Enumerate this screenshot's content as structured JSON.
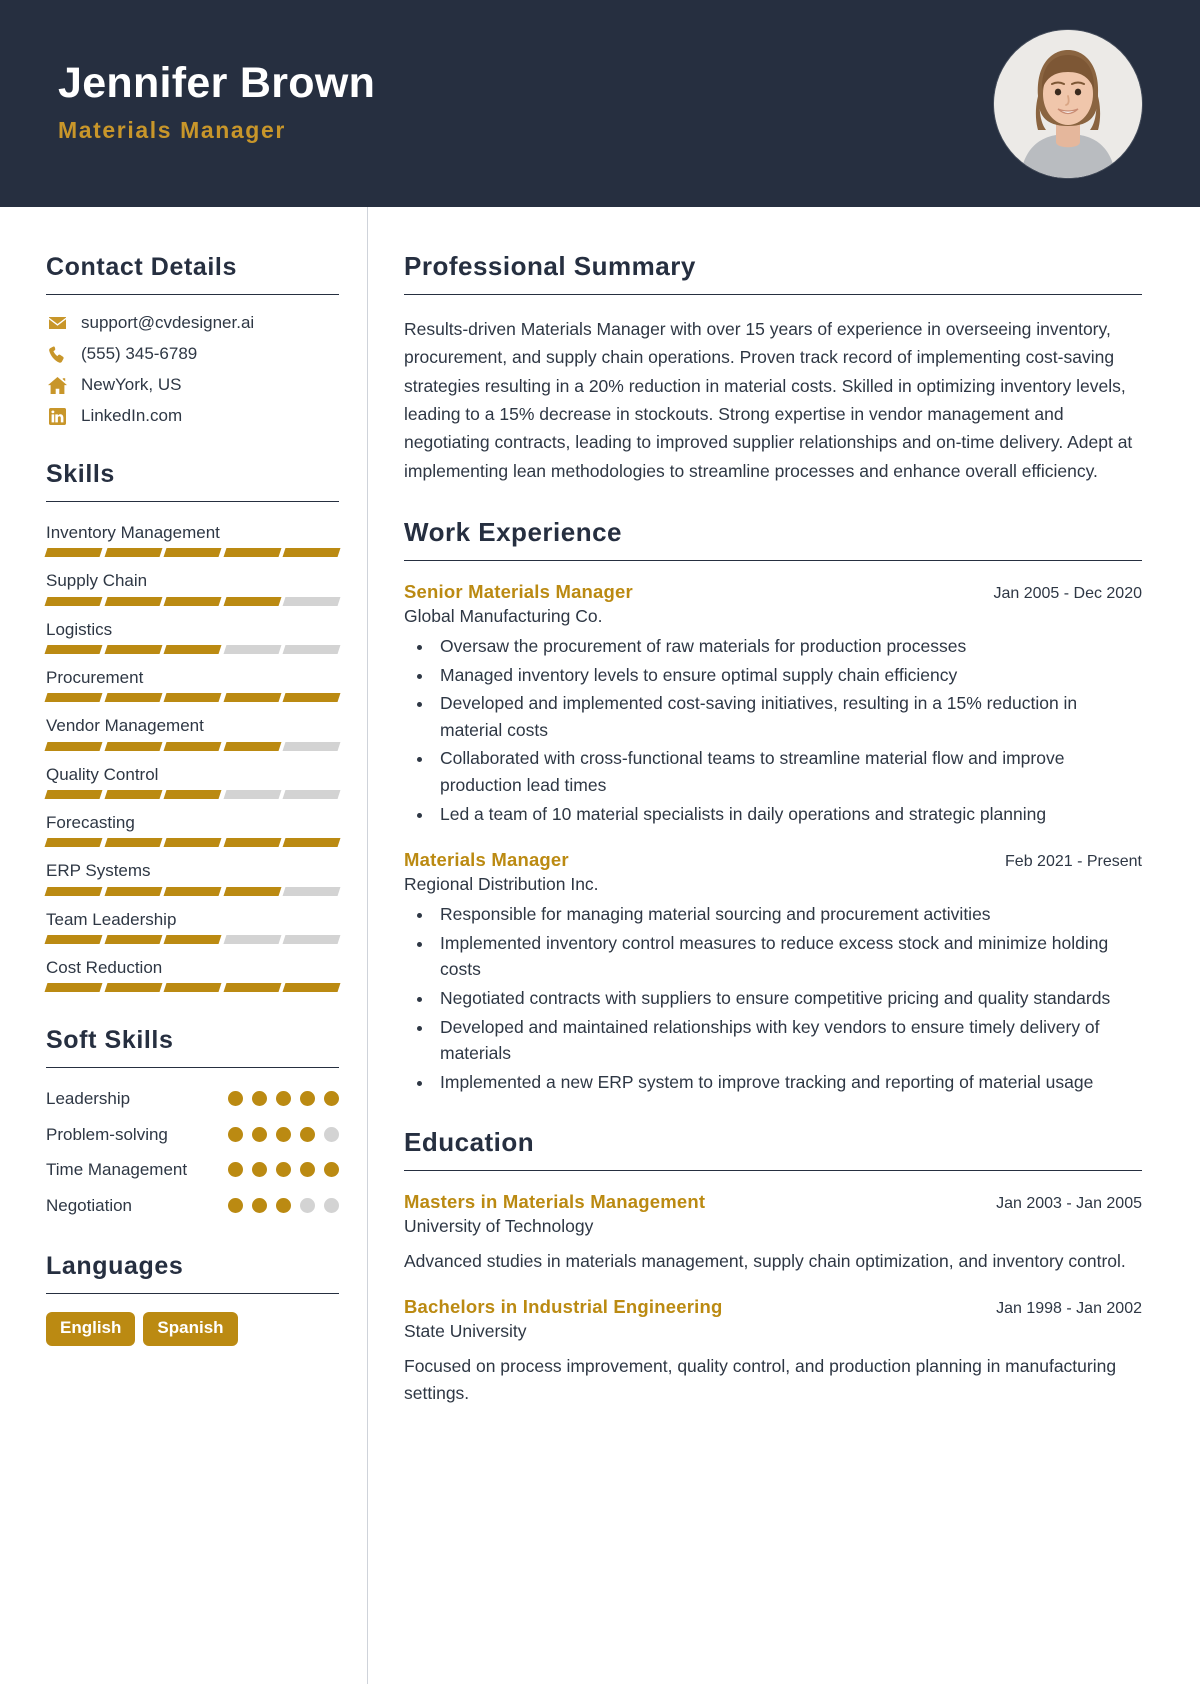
{
  "header": {
    "name": "Jennifer Brown",
    "role": "Materials Manager",
    "avatar_alt": "profile-photo"
  },
  "colors": {
    "header_bg": "#262f40",
    "accent": "#bb8a12",
    "role_accent": "#c8962a",
    "text": "#2e3744",
    "muted_bar": "#d3d3d3"
  },
  "sidebar": {
    "contact": {
      "title": "Contact Details",
      "items": [
        {
          "icon": "envelope-icon",
          "value": "support@cvdesigner.ai"
        },
        {
          "icon": "phone-icon",
          "value": "(555) 345-6789"
        },
        {
          "icon": "home-icon",
          "value": "NewYork, US"
        },
        {
          "icon": "linkedin-icon",
          "value": "LinkedIn.com"
        }
      ]
    },
    "skills": {
      "title": "Skills",
      "max": 5,
      "items": [
        {
          "label": "Inventory Management",
          "level": 5
        },
        {
          "label": "Supply Chain",
          "level": 4
        },
        {
          "label": "Logistics",
          "level": 3
        },
        {
          "label": "Procurement",
          "level": 5
        },
        {
          "label": "Vendor Management",
          "level": 4
        },
        {
          "label": "Quality Control",
          "level": 3
        },
        {
          "label": "Forecasting",
          "level": 5
        },
        {
          "label": "ERP Systems",
          "level": 4
        },
        {
          "label": "Team Leadership",
          "level": 3
        },
        {
          "label": "Cost Reduction",
          "level": 5
        }
      ]
    },
    "soft_skills": {
      "title": "Soft Skills",
      "max": 5,
      "items": [
        {
          "label": "Leadership",
          "level": 5
        },
        {
          "label": "Problem-solving",
          "level": 4
        },
        {
          "label": "Time Management",
          "level": 5
        },
        {
          "label": "Negotiation",
          "level": 3
        }
      ]
    },
    "languages": {
      "title": "Languages",
      "items": [
        "English",
        "Spanish"
      ]
    }
  },
  "main": {
    "summary": {
      "title": "Professional Summary",
      "text": "Results-driven Materials Manager with over 15 years of experience in overseeing inventory, procurement, and supply chain operations. Proven track record of implementing cost-saving strategies resulting in a 20% reduction in material costs. Skilled in optimizing inventory levels, leading to a 15% decrease in stockouts. Strong expertise in vendor management and negotiating contracts, leading to improved supplier relationships and on-time delivery. Adept at implementing lean methodologies to streamline processes and enhance overall efficiency."
    },
    "work": {
      "title": "Work Experience",
      "jobs": [
        {
          "title": "Senior Materials Manager",
          "date": "Jan 2005 - Dec 2020",
          "org": "Global Manufacturing Co.",
          "bullets": [
            "Oversaw the procurement of raw materials for production processes",
            "Managed inventory levels to ensure optimal supply chain efficiency",
            "Developed and implemented cost-saving initiatives, resulting in a 15% reduction in material costs",
            "Collaborated with cross-functional teams to streamline material flow and improve production lead times",
            "Led a team of 10 material specialists in daily operations and strategic planning"
          ]
        },
        {
          "title": "Materials Manager",
          "date": "Feb 2021 - Present",
          "org": "Regional Distribution Inc.",
          "bullets": [
            "Responsible for managing material sourcing and procurement activities",
            "Implemented inventory control measures to reduce excess stock and minimize holding costs",
            "Negotiated contracts with suppliers to ensure competitive pricing and quality standards",
            "Developed and maintained relationships with key vendors to ensure timely delivery of materials",
            "Implemented a new ERP system to improve tracking and reporting of material usage"
          ]
        }
      ]
    },
    "education": {
      "title": "Education",
      "items": [
        {
          "degree": "Masters in Materials Management",
          "date": "Jan 2003 - Jan 2005",
          "school": "University of Technology",
          "description": "Advanced studies in materials management, supply chain optimization, and inventory control."
        },
        {
          "degree": "Bachelors in Industrial Engineering",
          "date": "Jan 1998 - Jan 2002",
          "school": "State University",
          "description": "Focused on process improvement, quality control, and production planning in manufacturing settings."
        }
      ]
    }
  }
}
